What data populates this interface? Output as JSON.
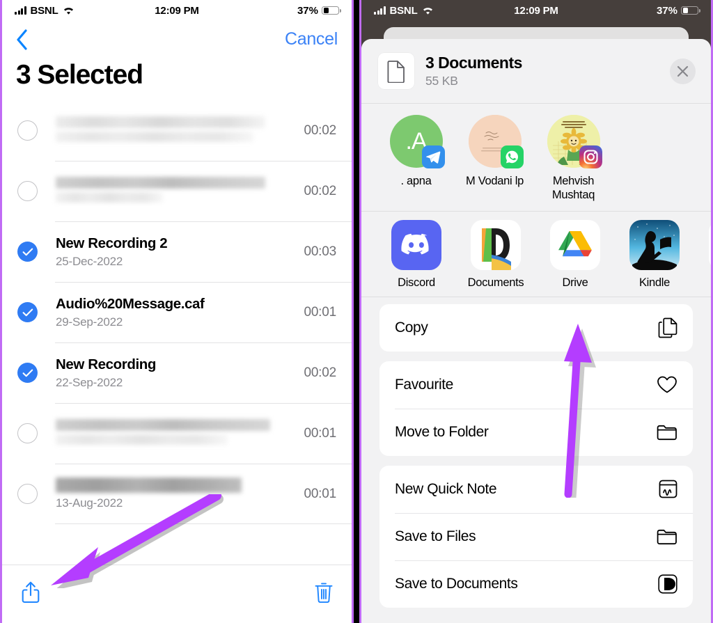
{
  "status_bar": {
    "carrier": "BSNL",
    "time": "12:09 PM",
    "battery": "37%",
    "wifi_icon": "wifi-icon",
    "signal_icon": "cellular-bars-icon",
    "battery_icon": "battery-icon"
  },
  "left_panel": {
    "nav": {
      "back_icon": "back-chevron-icon",
      "cancel_label": "Cancel"
    },
    "title": "3 Selected",
    "recordings": [
      {
        "name": "",
        "date": "",
        "duration": "00:02",
        "selected": false,
        "redacted": true,
        "redact_style": "light"
      },
      {
        "name": "",
        "date": "",
        "duration": "00:02",
        "selected": false,
        "redacted": true,
        "redact_style": "dark"
      },
      {
        "name": "New Recording 2",
        "date": "25-Dec-2022",
        "duration": "00:03",
        "selected": true,
        "redacted": false,
        "redact_style": ""
      },
      {
        "name": "Audio%20Message.caf",
        "date": "29-Sep-2022",
        "duration": "00:01",
        "selected": true,
        "redacted": false,
        "redact_style": ""
      },
      {
        "name": "New Recording",
        "date": "22-Sep-2022",
        "duration": "00:02",
        "selected": true,
        "redacted": false,
        "redact_style": ""
      },
      {
        "name": "",
        "date": "",
        "duration": "00:01",
        "selected": false,
        "redacted": true,
        "redact_style": "dark"
      },
      {
        "name": "",
        "date": "13-Aug-2022",
        "duration": "00:01",
        "selected": false,
        "redacted": true,
        "redact_style": "grey"
      }
    ],
    "toolbar": {
      "share_icon": "share-icon",
      "delete_icon": "trash-icon"
    }
  },
  "right_panel": {
    "share_sheet": {
      "doc_icon": "document-icon",
      "title": "3 Documents",
      "subtitle": "55 KB",
      "close_icon": "close-icon",
      "contacts": [
        {
          "name": ". apna",
          "initial": ".A",
          "avatar_color": "#7dc96f",
          "badge_app": "telegram-icon"
        },
        {
          "name": "M Vodani lp",
          "initial": "",
          "avatar_color": "#f6d5bd",
          "badge_app": "whatsapp-icon"
        },
        {
          "name": "Mehvish Mushtaq",
          "initial": "",
          "avatar_color": "#e9eda0",
          "badge_app": "instagram-icon"
        }
      ],
      "apps": [
        {
          "name": "Discord",
          "icon": "discord-icon"
        },
        {
          "name": "Documents",
          "icon": "documents-icon"
        },
        {
          "name": "Drive",
          "icon": "google-drive-icon"
        },
        {
          "name": "Kindle",
          "icon": "kindle-icon"
        },
        {
          "name": "",
          "icon": "more-apps-icon"
        }
      ],
      "action_groups": [
        {
          "items": [
            {
              "label": "Copy",
              "icon": "copy-icon"
            }
          ]
        },
        {
          "items": [
            {
              "label": "Favourite",
              "icon": "heart-icon"
            },
            {
              "label": "Move to Folder",
              "icon": "folder-icon"
            }
          ]
        },
        {
          "items": [
            {
              "label": "New Quick Note",
              "icon": "quick-note-icon"
            },
            {
              "label": "Save to Files",
              "icon": "folder-icon"
            },
            {
              "label": "Save to Documents",
              "icon": "documents-app-icon"
            }
          ]
        }
      ]
    }
  },
  "annotations": {
    "accent_color": "#b43dff",
    "arrow_left_name": "share-button-arrow",
    "arrow_right_name": "drive-app-arrow"
  }
}
